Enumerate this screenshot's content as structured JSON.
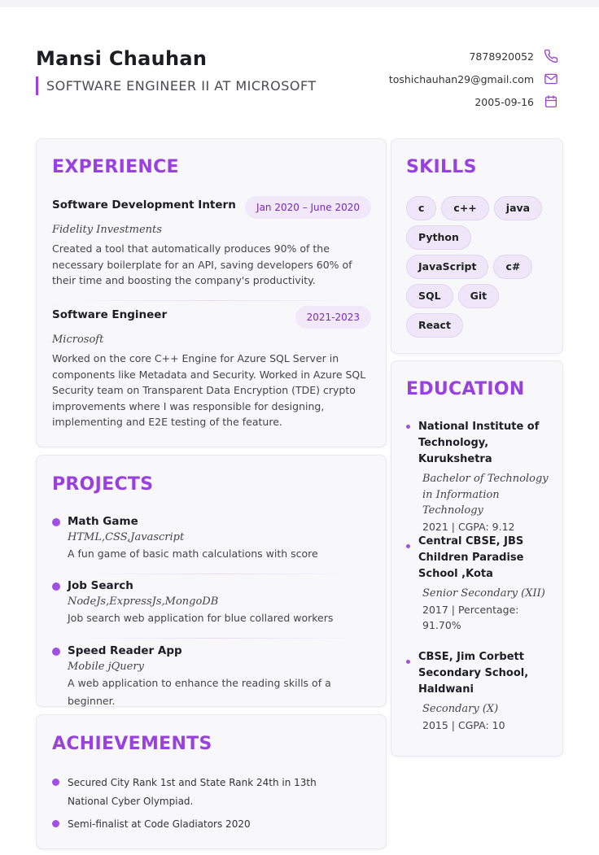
{
  "header": {
    "name": "Mansi Chauhan",
    "role": "SOFTWARE ENGINEER II AT MICROSOFT",
    "phone": "7878920052",
    "email": "toshichauhan29@gmail.com",
    "dob": "2005-09-16"
  },
  "colors": {
    "accent": "#9a3fe0",
    "chip_bg": "#efe6fa",
    "date_badge_bg": "#f1e8fa"
  },
  "experience": {
    "title": "EXPERIENCE",
    "items": [
      {
        "title": "Software Development Intern",
        "date": "Jan 2020 – June 2020",
        "company": "Fidelity Investments",
        "description": "Created a tool that automatically produces 90% of the necessary boilerplate for an API, saving developers 60% of their time and boosting the company's productivity."
      },
      {
        "title": "Software Engineer",
        "date": "2021-2023",
        "company": "Microsoft",
        "description": "Worked on the core C++ Engine for Azure SQL Server in components like Metadata and Security. Worked in Azure SQL Security team on Transparent Data Encryption (TDE) crypto improvements where I was responsible for designing, implementing and E2E testing of the feature."
      }
    ]
  },
  "projects": {
    "title": "PROJECTS",
    "items": [
      {
        "name": "Math Game",
        "tech": "HTML,CSS,Javascript",
        "description": "A fun game of basic math calculations with score"
      },
      {
        "name": "Job Search",
        "tech": "NodeJs,ExpressJs,MongoDB",
        "description": "Job search web application for blue collared workers"
      },
      {
        "name": "Speed Reader App",
        "tech": "Mobile jQuery",
        "description": "A web application to enhance the reading skills of a beginner."
      }
    ]
  },
  "achievements": {
    "title": "ACHIEVEMENTS",
    "items": [
      "Secured City Rank 1st and State Rank 24th in 13th National Cyber Olympiad.",
      "Semi-finalist at Code Gladiators 2020"
    ]
  },
  "skills": {
    "title": "SKILLS",
    "items": [
      "c",
      "c++",
      "java",
      "Python",
      "JavaScript",
      "c#",
      "SQL",
      "Git",
      "React"
    ]
  },
  "education": {
    "title": "EDUCATION",
    "items": [
      {
        "school": "National Institute of Technology, Kurukshetra",
        "degree": "Bachelor of Technology in Information Technology",
        "meta": "2021 | CGPA: 9.12"
      },
      {
        "school": "Central CBSE, JBS Children Paradise School ,Kota",
        "degree": "Senior Secondary (XII)",
        "meta": "2017 | Percentage: 91.70%"
      },
      {
        "school": "CBSE, Jim Corbett Secondary School, Haldwani",
        "degree": "Secondary (X)",
        "meta": "2015 | CGPA: 10"
      }
    ]
  }
}
